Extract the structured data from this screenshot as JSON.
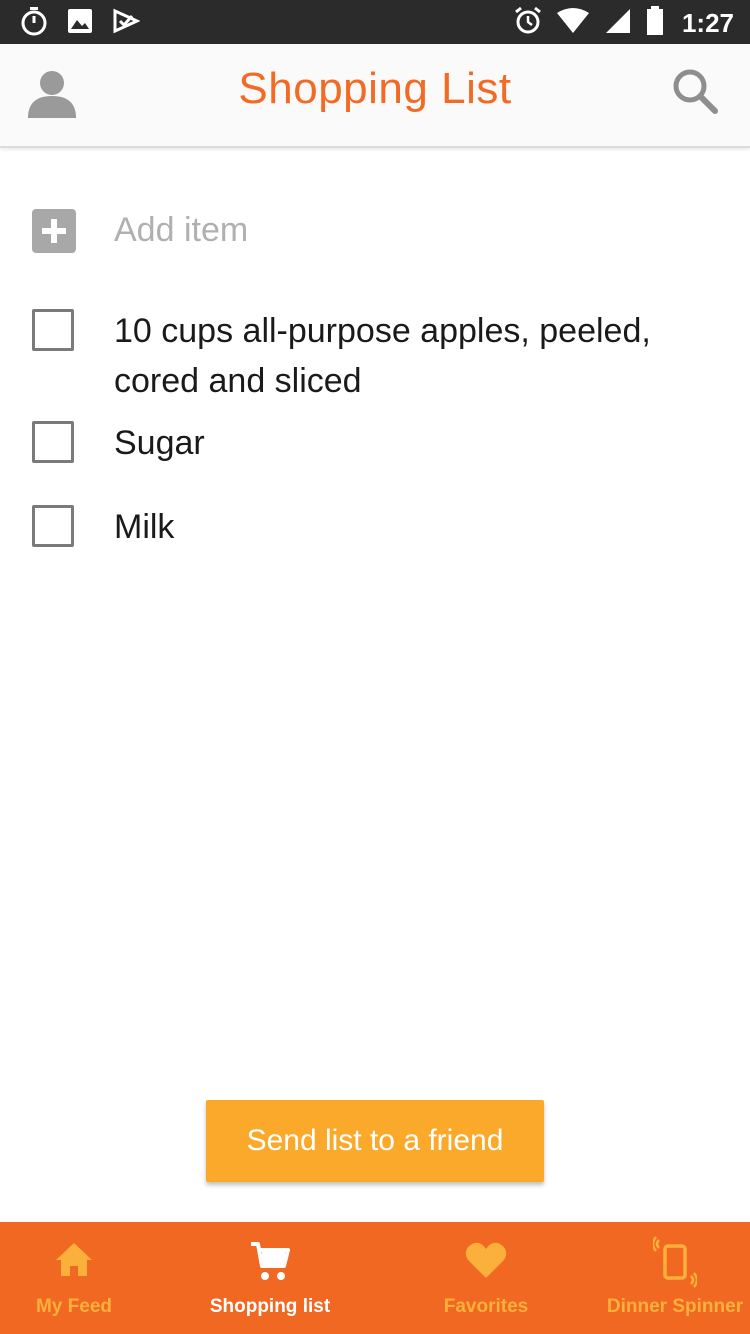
{
  "status_bar": {
    "time": "1:27",
    "left_icons": [
      "stopwatch-icon",
      "image-icon",
      "check-app-icon"
    ],
    "right_icons": [
      "alarm-icon",
      "wifi-icon",
      "signal-icon",
      "battery-icon"
    ]
  },
  "header": {
    "title": "Shopping List",
    "title_color": "#f26a24"
  },
  "add_item": {
    "placeholder": "Add item",
    "value": ""
  },
  "items": [
    {
      "text": "10 cups all-purpose apples, peeled, cored and sliced",
      "checked": false
    },
    {
      "text": "Sugar",
      "checked": false
    },
    {
      "text": "Milk",
      "checked": false
    }
  ],
  "send_button": {
    "label": "Send list to a friend",
    "color": "#fba92b"
  },
  "bottom_nav": {
    "background": "#f16822",
    "items": [
      {
        "label": "My Feed",
        "icon": "home-icon",
        "active": false
      },
      {
        "label": "Shopping list",
        "icon": "cart-icon",
        "active": true
      },
      {
        "label": "Favorites",
        "icon": "heart-icon",
        "active": false
      },
      {
        "label": "Dinner Spinner",
        "icon": "phone-shake-icon",
        "active": false
      }
    ]
  }
}
